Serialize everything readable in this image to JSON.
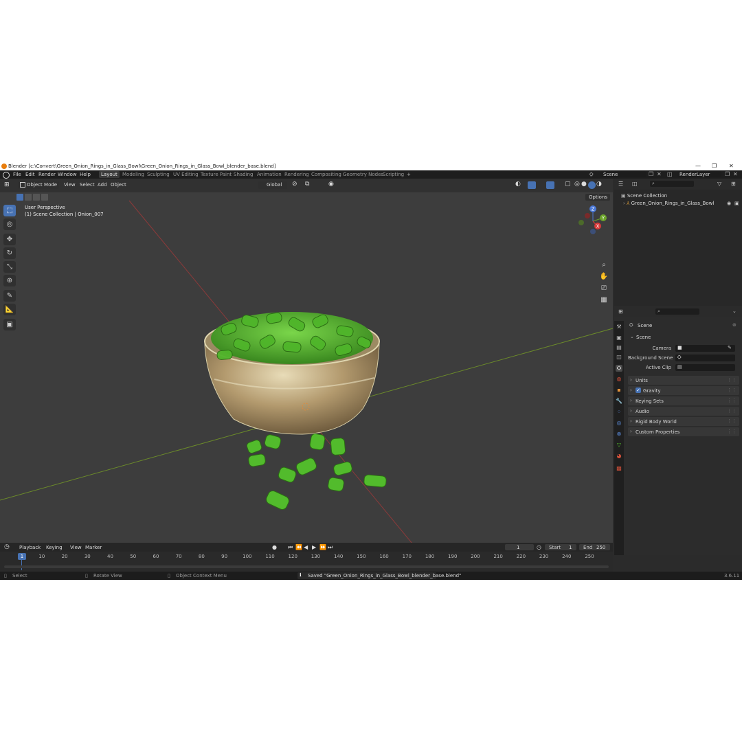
{
  "window": {
    "title": "Blender [c:\\Convert\\Green_Onion_Rings_in_Glass_Bowl\\Green_Onion_Rings_in_Glass_Bowl_blender_base.blend]",
    "minimize": "—",
    "maximize": "❐",
    "close": "✕"
  },
  "menu": [
    "File",
    "Edit",
    "Render",
    "Window",
    "Help"
  ],
  "workspaces": [
    "Layout",
    "Modeling",
    "Sculpting",
    "UV Editing",
    "Texture Paint",
    "Shading",
    "Animation",
    "Rendering",
    "Compositing",
    "Geometry Nodes",
    "Scripting"
  ],
  "workspace_add": "+",
  "scene_field": "Scene",
  "render_layer_field": "RenderLayer",
  "viewport": {
    "mode": "Object Mode",
    "menus": [
      "View",
      "Select",
      "Add",
      "Object"
    ],
    "transform_orientation": "Global",
    "options_label": "Options",
    "overlay_title": "User Perspective",
    "overlay_subtitle": "(1) Scene Collection | Onion_007",
    "gizmo": {
      "z": "Z",
      "y": "Y",
      "x": "X"
    }
  },
  "outliner": {
    "root": "Scene Collection",
    "items": [
      "Green_Onion_Rings_in_Glass_Bowl"
    ]
  },
  "properties": {
    "header": "Scene",
    "panel": "Scene",
    "fields": [
      {
        "label": "Camera"
      },
      {
        "label": "Background Scene"
      },
      {
        "label": "Active Clip"
      }
    ],
    "subpanels": [
      "Units",
      "Gravity",
      "Keying Sets",
      "Audio",
      "Rigid Body World",
      "Custom Properties"
    ]
  },
  "timeline": {
    "menus": [
      "Playback",
      "Keying",
      "View",
      "Marker"
    ],
    "current_frame": "1",
    "start_label": "Start",
    "start": "1",
    "end_label": "End",
    "end": "250",
    "ticks": [
      "1",
      "10",
      "20",
      "30",
      "40",
      "50",
      "60",
      "70",
      "80",
      "90",
      "100",
      "110",
      "120",
      "130",
      "140",
      "150",
      "160",
      "170",
      "180",
      "190",
      "200",
      "210",
      "220",
      "230",
      "240",
      "250"
    ]
  },
  "status": {
    "select": "Select",
    "rotate": "Rotate View",
    "context": "Object Context Menu",
    "message": "Saved \"Green_Onion_Rings_in_Glass_Bowl_blender_base.blend\"",
    "version": "3.6.11"
  },
  "colors": {
    "accent": "#4772b3",
    "onion_green": "#4fb52a",
    "bowl_gold": "#b8a37a",
    "viewport_bg": "#3d3d3d"
  }
}
